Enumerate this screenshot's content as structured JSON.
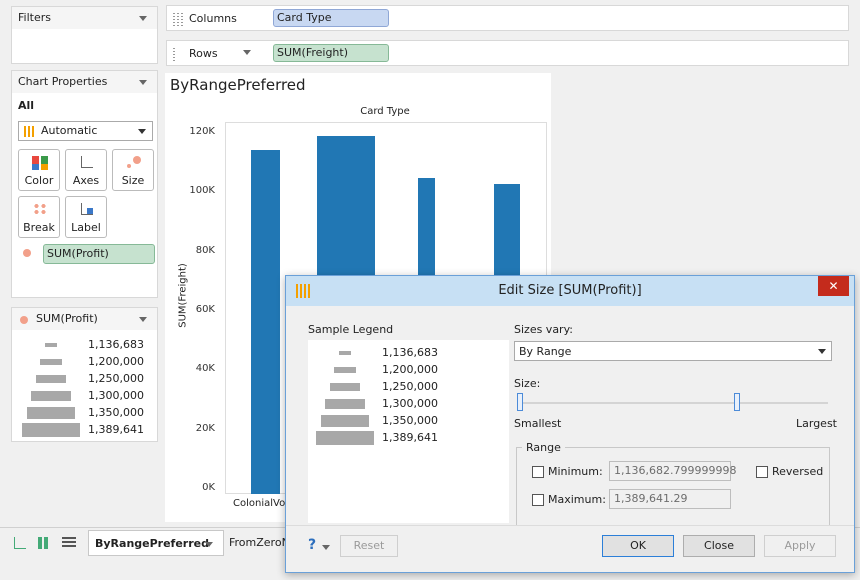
{
  "filters": {
    "title": "Filters"
  },
  "shelves": {
    "columns": {
      "label": "Columns",
      "pill": "Card Type"
    },
    "rows": {
      "label": "Rows",
      "pill": "SUM(Freight)"
    }
  },
  "chart_properties": {
    "title": "Chart Properties",
    "scope": "All",
    "mark_type": "Automatic",
    "buttons": [
      "Color",
      "Axes",
      "Size",
      "Break",
      "Label"
    ],
    "size_field": "SUM(Profit)"
  },
  "size_legend": {
    "title": "SUM(Profit)",
    "items": [
      "1,136,683",
      "1,200,000",
      "1,250,000",
      "1,300,000",
      "1,350,000",
      "1,389,641"
    ]
  },
  "chart_data": {
    "type": "bar",
    "title": "ByRangePreferred",
    "column_header": "Card Type",
    "ylabel": "SUM(Freight)",
    "ylim": [
      0,
      120000
    ],
    "yticks": [
      "0K",
      "20K",
      "40K",
      "60K",
      "80K",
      "100K",
      "120K"
    ],
    "tick_values": [
      0,
      20000,
      40000,
      60000,
      80000,
      100000,
      120000
    ],
    "categories": [
      "ColonialVoice",
      "",
      "",
      ""
    ],
    "values": [
      114000,
      118500,
      104500,
      102500
    ],
    "size_rank": [
      0.35,
      0.95,
      0.1,
      0.3
    ],
    "bar_color": "#2177b4"
  },
  "tabs": {
    "active": "ByRangePreferred",
    "next": "FromZeroNo"
  },
  "dialog": {
    "title": "Edit Size [SUM(Profit)]",
    "sample_legend_label": "Sample Legend",
    "legend_items": [
      "1,136,683",
      "1,200,000",
      "1,250,000",
      "1,300,000",
      "1,350,000",
      "1,389,641"
    ],
    "sizes_vary_label": "Sizes vary:",
    "sizes_vary_value": "By Range",
    "size_label": "Size:",
    "smallest": "Smallest",
    "largest": "Largest",
    "range_label": "Range",
    "minimum_label": "Minimum:",
    "minimum_value": "1,136,682.799999998",
    "maximum_label": "Maximum:",
    "maximum_value": "1,389,641.29",
    "reversed_label": "Reversed",
    "help": "?",
    "reset": "Reset",
    "ok": "OK",
    "close": "Close",
    "apply": "Apply",
    "titlebar_color": "#c7e0f4",
    "close_color": "#c42b1c"
  }
}
